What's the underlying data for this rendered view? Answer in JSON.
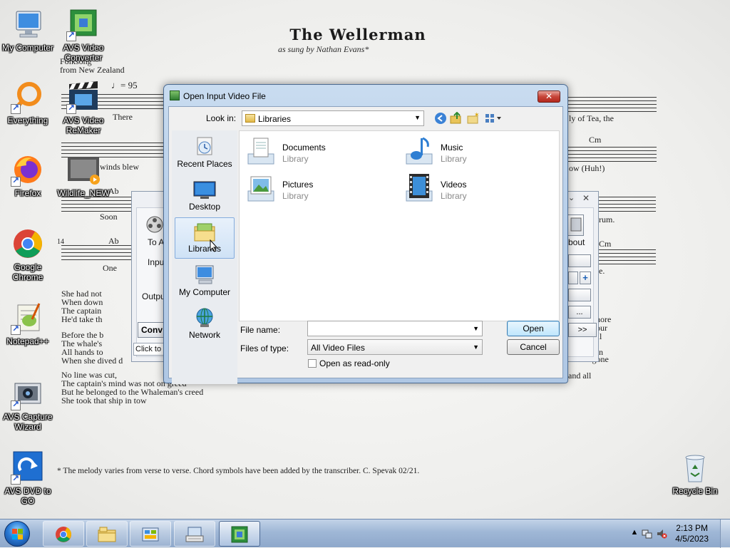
{
  "wallpaper": {
    "title": "The Wellerman",
    "subtitle": "as sung by Nathan Evans*",
    "folk_label": "Folksong\nfrom New Zealand",
    "tempo": "♩= 95",
    "lyric_fragments": {
      "l1": "There",
      "l2": "winds  blew",
      "l3": "Soon",
      "l4": "One",
      "r1": "ly  of   Tea,  the",
      "r2": "Cm",
      "r3": "ow   (Huh!)",
      "r4": "rum.",
      "r5": "Cm",
      "r6": "e.",
      "bar_num": "14",
      "chord_ab1": "Ab",
      "chord_ab2": "Ab"
    },
    "verse_lines_left": [
      "She had not",
      "When down",
      "The captain",
      "He'd take th",
      "Before the b",
      "The whale's",
      "All hands to",
      "When she dived d",
      "No line was cut,",
      "The captain's mind was not on greed",
      "But he belonged to the Whaleman's creed",
      "She took that ship in tow"
    ],
    "verse_lines_right": [
      "nore",
      "our",
      "r call",
      "rew",
      "n",
      "e's not gone",
      "and all"
    ],
    "footnote": "* The melody varies from verse to verse. Chord symbols have been added by the transcriber. C. Spevak 02/21."
  },
  "desktop_icons": [
    {
      "label": "My Computer",
      "icon": "computer-icon"
    },
    {
      "label": "AVS Video Converter",
      "icon": "avs-converter-icon"
    },
    {
      "label": "Everything",
      "icon": "everything-icon"
    },
    {
      "label": "AVS Video ReMaker",
      "icon": "avs-remaker-icon"
    },
    {
      "label": "Firefox",
      "icon": "firefox-icon"
    },
    {
      "label": "Wildlife_NEW",
      "icon": "video-file-icon"
    },
    {
      "label": "Google Chrome",
      "icon": "chrome-icon"
    },
    {
      "label": "Notepad++",
      "icon": "notepadpp-icon"
    },
    {
      "label": "AVS Capture Wizard",
      "icon": "capture-icon"
    },
    {
      "label": "AVS DVD to GO",
      "icon": "dvd-icon"
    },
    {
      "label": "Recycle Bin",
      "icon": "recycle-bin-icon"
    }
  ],
  "background_window": {
    "to_label": "To A",
    "input_label": "Input",
    "output_label": "Outpu",
    "convert_label": "Conv",
    "click_to": "Click to",
    "about_label": "bout",
    "plus": "+",
    "more": ">>",
    "dots": "..."
  },
  "dialog": {
    "title": "Open Input Video File",
    "close_glyph": "✕",
    "look_in_label": "Look in:",
    "look_in_value": "Libraries",
    "places": [
      {
        "label": "Recent Places",
        "icon": "recent-places-icon"
      },
      {
        "label": "Desktop",
        "icon": "desktop-icon"
      },
      {
        "label": "Libraries",
        "icon": "libraries-icon"
      },
      {
        "label": "My Computer",
        "icon": "computer-icon"
      },
      {
        "label": "Network",
        "icon": "network-icon"
      }
    ],
    "libraries": [
      {
        "name": "Documents",
        "type": "Library",
        "icon": "documents-library-icon"
      },
      {
        "name": "Music",
        "type": "Library",
        "icon": "music-library-icon"
      },
      {
        "name": "Pictures",
        "type": "Library",
        "icon": "pictures-library-icon"
      },
      {
        "name": "Videos",
        "type": "Library",
        "icon": "videos-library-icon"
      }
    ],
    "file_name_label": "File name:",
    "file_name_value": "",
    "files_of_type_label": "Files of type:",
    "files_of_type_value": "All Video Files",
    "open_read_only_label": "Open as read-only",
    "open_button": "Open",
    "cancel_button": "Cancel"
  },
  "taskbar": {
    "time": "2:13 PM",
    "date": "4/5/2023",
    "buttons": [
      "chrome-icon",
      "explorer-icon",
      "control-panel-icon",
      "keyboard-icon",
      "avs-converter-icon"
    ]
  }
}
